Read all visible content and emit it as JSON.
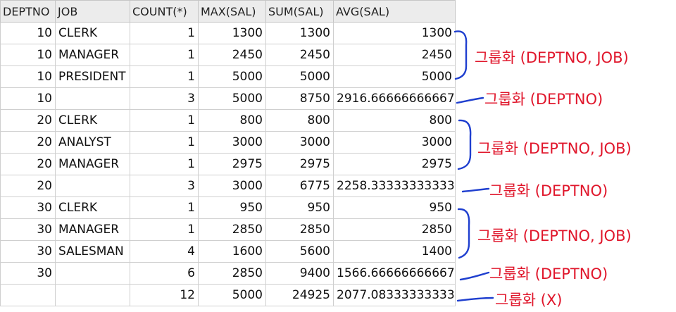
{
  "columns": [
    "DEPTNO",
    "JOB",
    "COUNT(*)",
    "MAX(SAL)",
    "SUM(SAL)",
    "AVG(SAL)"
  ],
  "rows": [
    {
      "deptno": "10",
      "job": "CLERK",
      "count": "1",
      "max": "1300",
      "sum": "1300",
      "avg": "1300"
    },
    {
      "deptno": "10",
      "job": "MANAGER",
      "count": "1",
      "max": "2450",
      "sum": "2450",
      "avg": "2450"
    },
    {
      "deptno": "10",
      "job": "PRESIDENT",
      "count": "1",
      "max": "5000",
      "sum": "5000",
      "avg": "5000"
    },
    {
      "deptno": "10",
      "job": "",
      "count": "3",
      "max": "5000",
      "sum": "8750",
      "avg": "2916.66666666667"
    },
    {
      "deptno": "20",
      "job": "CLERK",
      "count": "1",
      "max": "800",
      "sum": "800",
      "avg": "800"
    },
    {
      "deptno": "20",
      "job": "ANALYST",
      "count": "1",
      "max": "3000",
      "sum": "3000",
      "avg": "3000"
    },
    {
      "deptno": "20",
      "job": "MANAGER",
      "count": "1",
      "max": "2975",
      "sum": "2975",
      "avg": "2975"
    },
    {
      "deptno": "20",
      "job": "",
      "count": "3",
      "max": "3000",
      "sum": "6775",
      "avg": "2258.33333333333"
    },
    {
      "deptno": "30",
      "job": "CLERK",
      "count": "1",
      "max": "950",
      "sum": "950",
      "avg": "950"
    },
    {
      "deptno": "30",
      "job": "MANAGER",
      "count": "1",
      "max": "2850",
      "sum": "2850",
      "avg": "2850"
    },
    {
      "deptno": "30",
      "job": "SALESMAN",
      "count": "4",
      "max": "1600",
      "sum": "5600",
      "avg": "1400"
    },
    {
      "deptno": "30",
      "job": "",
      "count": "6",
      "max": "2850",
      "sum": "9400",
      "avg": "1566.66666666667"
    },
    {
      "deptno": "",
      "job": "",
      "count": "12",
      "max": "5000",
      "sum": "24925",
      "avg": "2077.08333333333"
    }
  ],
  "annotations": {
    "group_dept_job": "그룹화 (DEPTNO, JOB)",
    "group_dept": "그룹화 (DEPTNO)",
    "group_none": "그룹화 (X)",
    "color_text": "#e0162b",
    "color_marks": "#1f3fcf"
  }
}
